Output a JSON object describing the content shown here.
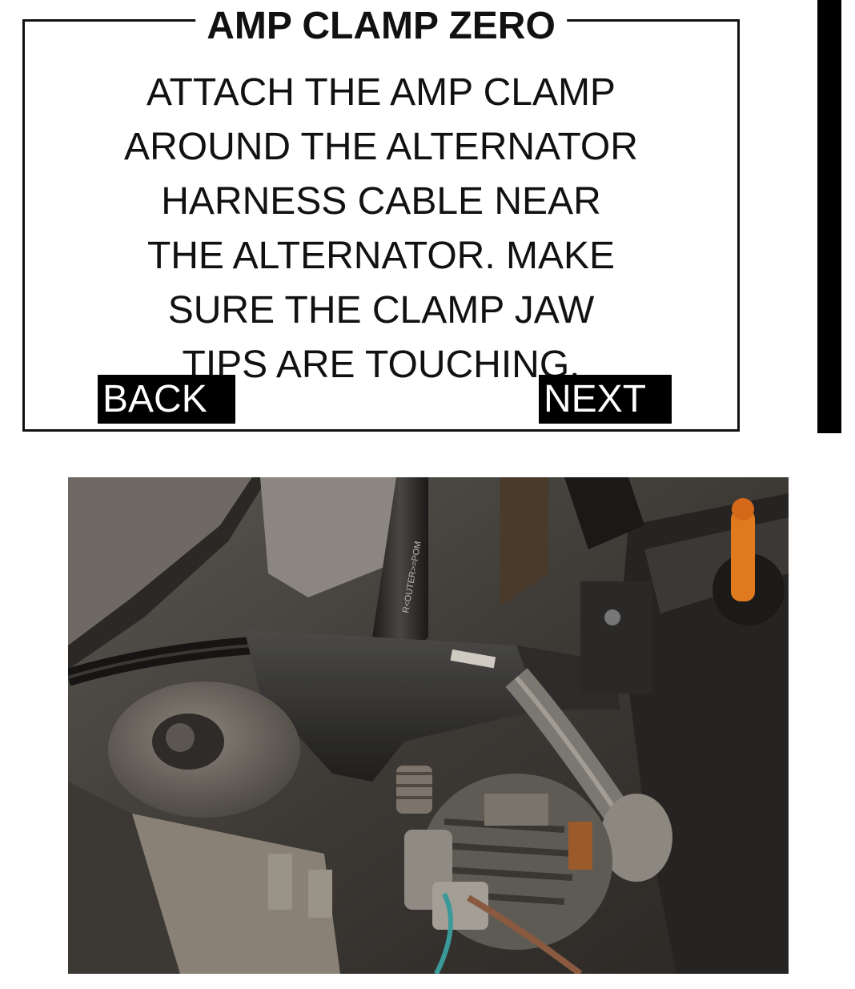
{
  "screen": {
    "title": "AMP CLAMP ZERO",
    "lines": [
      "ATTACH THE AMP CLAMP",
      "AROUND THE ALTERNATOR",
      "HARNESS CABLE NEAR",
      "THE ALTERNATOR.  MAKE",
      "SURE THE CLAMP JAW",
      "TIPS ARE TOUCHING."
    ],
    "back_label": "BACK",
    "next_label": "NEXT"
  },
  "photo": {
    "subject": "amp clamp around alternator harness cable in engine bay",
    "hose_print": "R<OUTER>=POM"
  },
  "colors": {
    "text": "#111111",
    "softkey_bg": "#000000",
    "softkey_text": "#ffffff",
    "oil_cap": "#e07a1e"
  }
}
